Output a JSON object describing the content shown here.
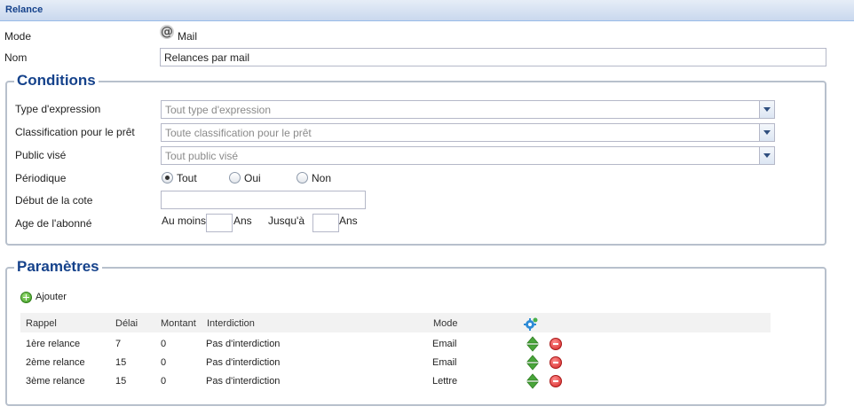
{
  "header": {
    "title": "Relance"
  },
  "mode": {
    "label": "Mode",
    "value": "Mail"
  },
  "nom": {
    "label": "Nom",
    "value": "Relances par mail"
  },
  "conditions": {
    "legend": "Conditions",
    "type_expression": {
      "label": "Type d'expression",
      "value": "Tout type d'expression"
    },
    "classification": {
      "label": "Classification pour le prêt",
      "value": "Toute classification pour le prêt"
    },
    "public_vise": {
      "label": "Public visé",
      "value": "Tout public visé"
    },
    "periodique": {
      "label": "Périodique",
      "options": [
        "Tout",
        "Oui",
        "Non"
      ],
      "selected": "Tout"
    },
    "debut_cote": {
      "label": "Début de la cote",
      "value": ""
    },
    "age": {
      "label": "Age de l'abonné",
      "au_moins": "Au moins",
      "ans1": "Ans",
      "jusqua": "Jusqu'à",
      "ans2": "Ans",
      "min_value": "",
      "max_value": ""
    }
  },
  "parametres": {
    "legend": "Paramètres",
    "add_label": "Ajouter",
    "columns": [
      "Rappel",
      "Délai",
      "Montant",
      "Interdiction",
      "Mode"
    ],
    "rows": [
      {
        "rappel": "1ère relance",
        "delai": "7",
        "montant": "0",
        "interdiction": "Pas d'interdiction",
        "mode": "Email"
      },
      {
        "rappel": "2ème relance",
        "delai": "15",
        "montant": "0",
        "interdiction": "Pas d'interdiction",
        "mode": "Email"
      },
      {
        "rappel": "3ème relance",
        "delai": "15",
        "montant": "0",
        "interdiction": "Pas d'interdiction",
        "mode": "Lettre"
      }
    ]
  },
  "icons": {
    "mode_icon": "at-sign-icon",
    "add_icon": "add-icon",
    "settings_icon": "gear-icon",
    "move_icon": "up-down-arrows-icon",
    "delete_icon": "delete-icon"
  },
  "colors": {
    "header_text": "#15428b",
    "legend_text": "#15428b",
    "border": "#b7c0cc",
    "arrow_green": "#49a53a",
    "delete_red": "#d42424"
  }
}
